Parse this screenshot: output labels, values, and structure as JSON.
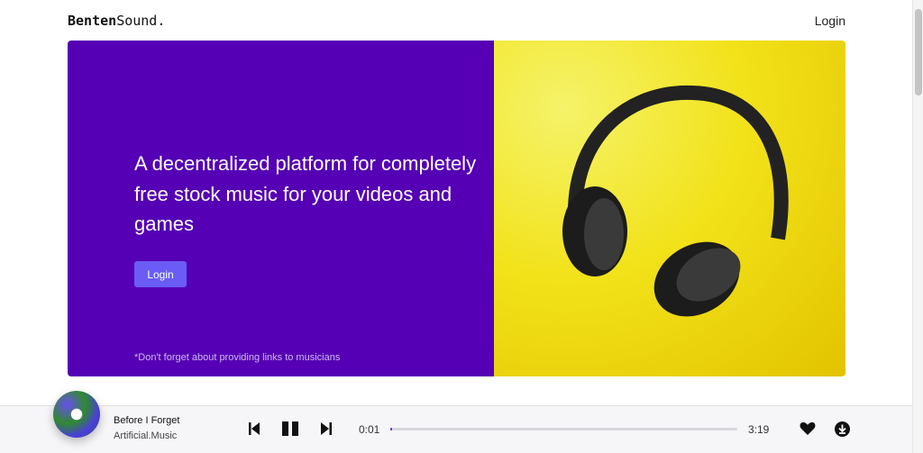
{
  "nav": {
    "logo_bold": "Benten",
    "logo_rest": "Sound.",
    "login": "Login"
  },
  "hero": {
    "headline": "A decentralized platform for completely free stock music for your videos and games",
    "login_button": "Login",
    "note": "*Don't forget about providing links to musicians"
  },
  "player": {
    "track": "Before I Forget",
    "artist": "Artificial.Music",
    "current_time": "0:01",
    "duration": "3:19",
    "progress_percent": 0.5,
    "accent": "#6a2ac9"
  }
}
